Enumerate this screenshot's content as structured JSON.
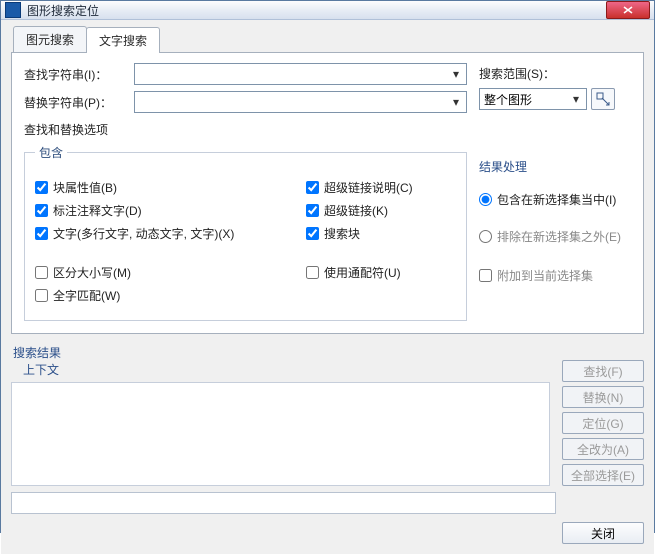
{
  "title": "图形搜索定位",
  "tabs": [
    "图元搜索",
    "文字搜索"
  ],
  "left": {
    "find_label": "查找字符串(I)：",
    "find_value": "",
    "replace_label": "替换字符串(P)：",
    "replace_value": "",
    "options_title": "查找和替换选项",
    "include_legend": "包含",
    "include": [
      "块属性值(B)",
      "标注注释文字(D)",
      "文字(多行文字, 动态文字, 文字)(X)",
      "超级链接说明(C)",
      "超级链接(K)",
      "搜索块"
    ],
    "match": [
      "区分大小写(M)",
      "全字匹配(W)",
      "使用通配符(U)"
    ]
  },
  "right": {
    "scope_label": "搜索范围(S)：",
    "scope_value": "整个图形",
    "result_title": "结果处理",
    "radios": [
      "包含在新选择集当中(I)",
      "排除在新选择集之外(E)"
    ],
    "append": "附加到当前选择集"
  },
  "results": {
    "label": "搜索结果",
    "context": "上下文"
  },
  "buttons": [
    "查找(F)",
    "替换(N)",
    "定位(G)",
    "全改为(A)",
    "全部选择(E)"
  ],
  "close_label": "关闭"
}
